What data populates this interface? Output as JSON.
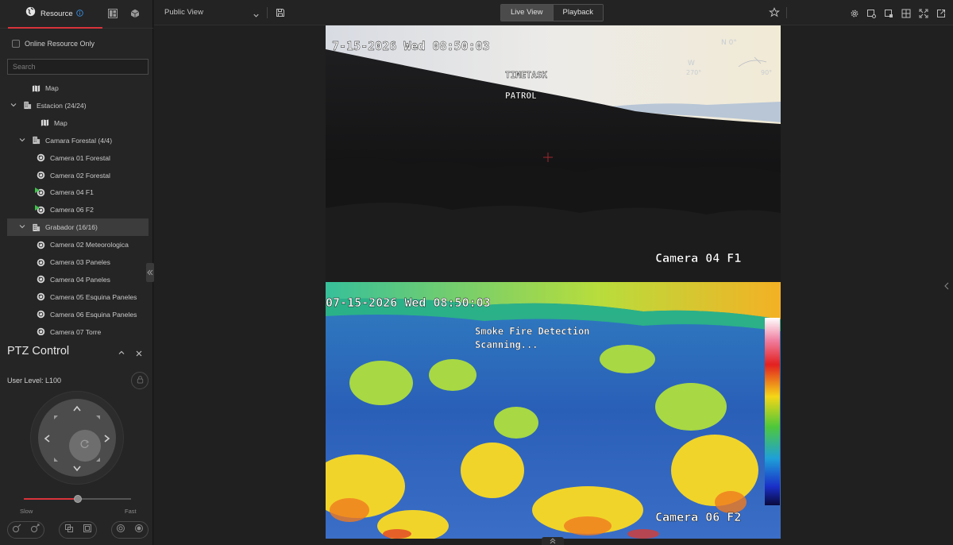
{
  "left_panel": {
    "tab_resource": "Resource",
    "online_only_label": "Online Resource Only",
    "search_placeholder": "Search",
    "tree": [
      {
        "label": "Map",
        "icon": "map-icon",
        "indent": 1,
        "arrow": "",
        "status": ""
      },
      {
        "label": "Estacion (24/24)",
        "icon": "building-icon",
        "indent": 0,
        "arrow": "down",
        "status": ""
      },
      {
        "label": "Map",
        "icon": "map-icon",
        "indent": 2,
        "arrow": "",
        "status": ""
      },
      {
        "label": "Camara Forestal (4/4)",
        "icon": "building-icon",
        "indent": 1,
        "arrow": "down",
        "status": ""
      },
      {
        "label": "Camera 01 Forestal",
        "icon": "camera-icon",
        "indent": 3,
        "arrow": "",
        "status": ""
      },
      {
        "label": "Camera 02 Forestal",
        "icon": "camera-icon",
        "indent": 3,
        "arrow": "",
        "status": ""
      },
      {
        "label": "Camera 04 F1",
        "icon": "camera-icon",
        "indent": 3,
        "arrow": "",
        "status": "playing"
      },
      {
        "label": "Camera 06 F2",
        "icon": "camera-icon",
        "indent": 3,
        "arrow": "",
        "status": "playing"
      },
      {
        "label": "Grabador (16/16)",
        "icon": "building-icon",
        "indent": 1,
        "arrow": "down",
        "status": "",
        "selected": true
      },
      {
        "label": "Camera 02 Meteorologica",
        "icon": "camera-icon",
        "indent": 3,
        "arrow": "",
        "status": ""
      },
      {
        "label": "Camera 03 Paneles",
        "icon": "camera-icon",
        "indent": 3,
        "arrow": "",
        "status": ""
      },
      {
        "label": "Camera 04 Paneles",
        "icon": "camera-icon",
        "indent": 3,
        "arrow": "",
        "status": ""
      },
      {
        "label": "Camera 05 Esquina Paneles",
        "icon": "camera-icon",
        "indent": 3,
        "arrow": "",
        "status": ""
      },
      {
        "label": "Camera 06 Esquina Paneles",
        "icon": "camera-icon",
        "indent": 3,
        "arrow": "",
        "status": ""
      },
      {
        "label": "Camera 07 Torre",
        "icon": "camera-icon",
        "indent": 3,
        "arrow": "",
        "status": ""
      }
    ]
  },
  "ptz": {
    "title": "PTZ Control",
    "user_level": "User Level: L100",
    "speed_slow": "Slow",
    "speed_fast": "Fast",
    "speed_level": 0.5
  },
  "topbar": {
    "view_name": "Public View",
    "live_view": "Live View",
    "playback": "Playback"
  },
  "cameras": [
    {
      "timestamp": "7-15-2026 Wed 08:50:03",
      "overlay_line1": "TIMETASK",
      "overlay_line2": "PATROL",
      "name": "Camera 04 F1",
      "compass_north": "N 0°",
      "compass_west": "W",
      "compass_w_deg": "270°",
      "compass_e_deg": "90°"
    },
    {
      "timestamp": "07-15-2026 Wed 08:50:03",
      "overlay_line1": "Smoke Fire Detection",
      "overlay_line2": "Scanning...",
      "name": "Camera 06 F2"
    }
  ],
  "colors": {
    "accent": "#d8333a",
    "playing": "#3fbf4a",
    "osd_text": "#ffffff"
  }
}
